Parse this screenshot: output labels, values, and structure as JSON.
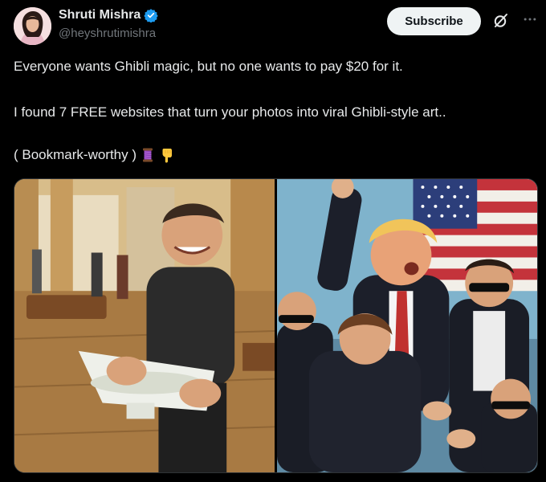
{
  "author": {
    "display_name": "Shruti Mishra",
    "handle": "@heyshrutimishra",
    "verified": true,
    "avatar_icon": "profile-photo"
  },
  "actions": {
    "subscribe_label": "Subscribe",
    "grok_icon": "grok-icon",
    "more_icon": "more-icon"
  },
  "tweet": {
    "line1": "Everyone wants Ghibli magic, but no one wants to pay $20 for it.",
    "line2": "I found 7 FREE websites that turn your photos into viral Ghibli-style art..",
    "line3": "( Bookmark-worthy )",
    "line3_emojis": [
      "thread-spool-emoji",
      "pointing-down-emoji"
    ]
  },
  "media": {
    "images": [
      {
        "name": "ghibli-man-carrying-sink-image"
      },
      {
        "name": "ghibli-crowd-with-flag-image"
      }
    ]
  },
  "colors": {
    "background": "#000000",
    "text": "#e7e9ea",
    "muted": "#71767b",
    "verified_blue": "#1d9bf0",
    "button_bg": "#eff3f4"
  }
}
